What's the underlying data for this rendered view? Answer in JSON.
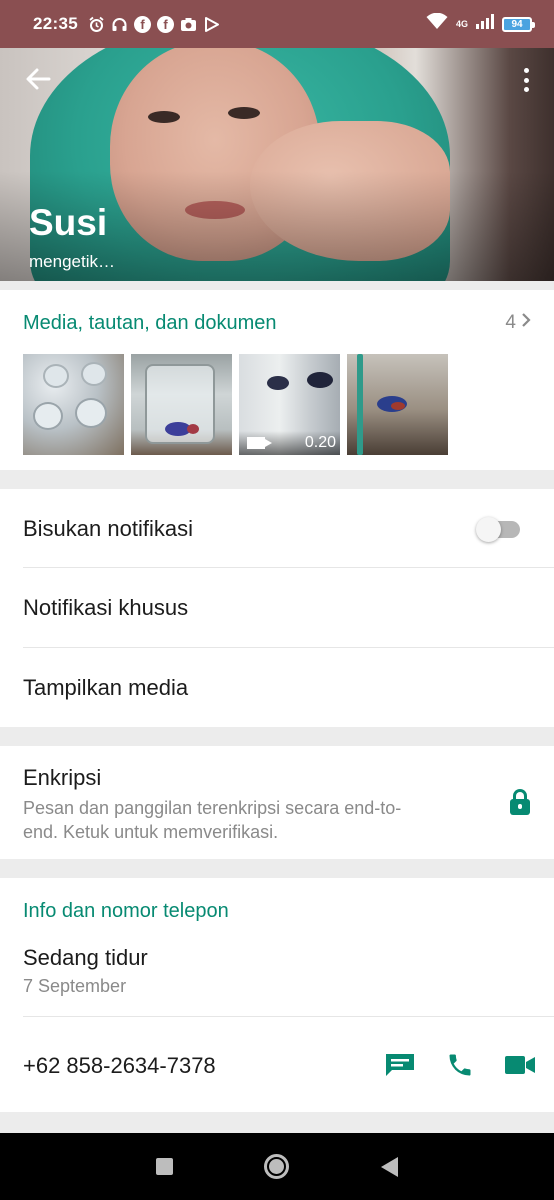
{
  "status_bar": {
    "time": "22:35",
    "network": "4G",
    "battery": "94",
    "icons": [
      "alarm-icon",
      "headset-icon",
      "facebook-icon",
      "facebook-icon",
      "camera-icon",
      "play-store-icon"
    ]
  },
  "contact": {
    "name": "Susi",
    "status": "mengetik…"
  },
  "media": {
    "title": "Media, tautan, dan dokumen",
    "count": "4",
    "video_duration": "0.20"
  },
  "settings": {
    "mute_label": "Bisukan notifikasi",
    "mute_on": false,
    "custom_notif_label": "Notifikasi khusus",
    "show_media_label": "Tampilkan media"
  },
  "encryption": {
    "title": "Enkripsi",
    "description": "Pesan dan panggilan terenkripsi secara end-to-end. Ketuk untuk memverifikasi."
  },
  "info": {
    "title": "Info dan nomor telepon",
    "about": "Sedang tidur",
    "about_date": "7 September",
    "phone": "+62 858-2634-7378"
  },
  "colors": {
    "accent": "#078a72",
    "status_bar": "#8a4f51"
  }
}
